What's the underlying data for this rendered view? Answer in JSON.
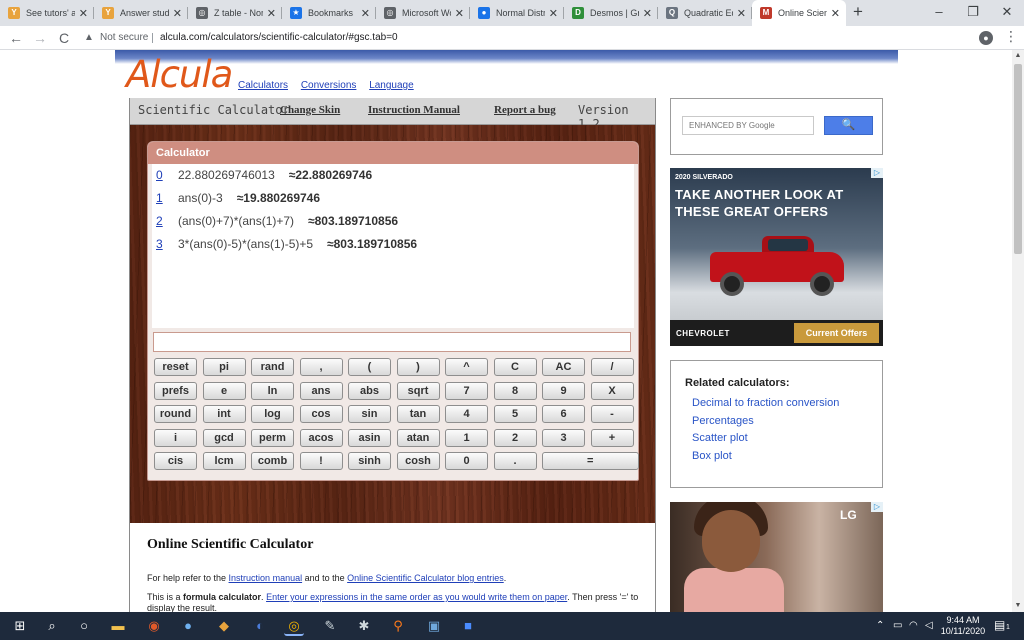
{
  "browser": {
    "tabs": [
      {
        "title": "See tutors' an",
        "fav": "Y",
        "color": "#e8a33d",
        "active": false
      },
      {
        "title": "Answer stude",
        "fav": "Y",
        "color": "#e8a33d",
        "active": false
      },
      {
        "title": "Z table - Nor",
        "fav": "◎",
        "color": "#5f6368",
        "active": false
      },
      {
        "title": "Bookmarks",
        "fav": "★",
        "color": "#1a73e8",
        "active": false
      },
      {
        "title": "Microsoft Wo",
        "fav": "◎",
        "color": "#5f6368",
        "active": false
      },
      {
        "title": "Normal Distr",
        "fav": "●",
        "color": "#1a73e8",
        "active": false
      },
      {
        "title": "Desmos | Gra",
        "fav": "D",
        "color": "#2f8f3a",
        "active": false
      },
      {
        "title": "Quadratic Eq",
        "fav": "Q",
        "color": "#6b7480",
        "active": false
      },
      {
        "title": "Online Scient",
        "fav": "M",
        "color": "#c0392b",
        "active": true
      }
    ],
    "new_tab": "+",
    "window_controls": {
      "minimize": "–",
      "maximize": "❐",
      "close": "✕"
    },
    "nav": {
      "back": "←",
      "forward": "→",
      "reload": "C"
    },
    "not_secure": "Not secure",
    "url": "alcula.com/calculators/scientific-calculator/#gsc.tab=0"
  },
  "site": {
    "logo": "Alcula",
    "nav": [
      "Calculators",
      "Conversions",
      "Language"
    ],
    "calc_header": {
      "title": "Scientific Calculator",
      "links": [
        "Change Skin",
        "Instruction Manual",
        "Report a bug"
      ],
      "version": "Version 1.2"
    },
    "panel_title": "Calculator",
    "history": [
      {
        "idx": "0",
        "expr": "22.880269746013",
        "res": "≈22.880269746"
      },
      {
        "idx": "1",
        "expr": "ans(0)-3",
        "res": "≈19.880269746"
      },
      {
        "idx": "2",
        "expr": "(ans(0)+7)*(ans(1)+7)",
        "res": "≈803.189710856"
      },
      {
        "idx": "3",
        "expr": "3*(ans(0)-5)*(ans(1)-5)+5",
        "res": "≈803.189710856"
      }
    ],
    "keys": [
      [
        "reset",
        "pi",
        "rand",
        ",",
        "(",
        ")",
        "^",
        "C",
        "AC",
        "/"
      ],
      [
        "prefs",
        "e",
        "ln",
        "ans",
        "abs",
        "sqrt",
        "7",
        "8",
        "9",
        "X"
      ],
      [
        "round",
        "int",
        "log",
        "cos",
        "sin",
        "tan",
        "4",
        "5",
        "6",
        "-"
      ],
      [
        "i",
        "gcd",
        "perm",
        "acos",
        "asin",
        "atan",
        "1",
        "2",
        "3",
        "+"
      ],
      [
        "cis",
        "lcm",
        "comb",
        "!",
        "sinh",
        "cosh",
        "0",
        ".",
        "="
      ]
    ],
    "article": {
      "heading": "Online Scientific Calculator",
      "p1_pre": "For help refer to the ",
      "p1_link1": "Instruction manual",
      "p1_mid": " and to the ",
      "p1_link2": "Online Scientific Calculator blog entries",
      "p1_end": ".",
      "p2_pre": "This is a ",
      "p2_bold": "formula calculator",
      "p2_mid": ". ",
      "p2_link": "Enter your expressions in the same order as you would write them on paper",
      "p2_end": ". Then press '=' to display the result."
    },
    "search": {
      "placeholder": "ENHANCED BY Google",
      "button": "🔍"
    },
    "ad1": {
      "brand_small": "2020 SILVERADO",
      "headline": "TAKE ANOTHER LOOK AT THESE GREAT OFFERS",
      "brand": "CHEVROLET",
      "cta": "Current Offers"
    },
    "related": {
      "heading": "Related calculators:",
      "links": [
        "Decimal to fraction conversion",
        "Percentages",
        "Scatter plot",
        "Box plot"
      ]
    },
    "ad2": {
      "brand": "LG"
    }
  },
  "taskbar": {
    "time": "9:44 AM",
    "date": "10/11/2020",
    "notification_count": "1"
  }
}
